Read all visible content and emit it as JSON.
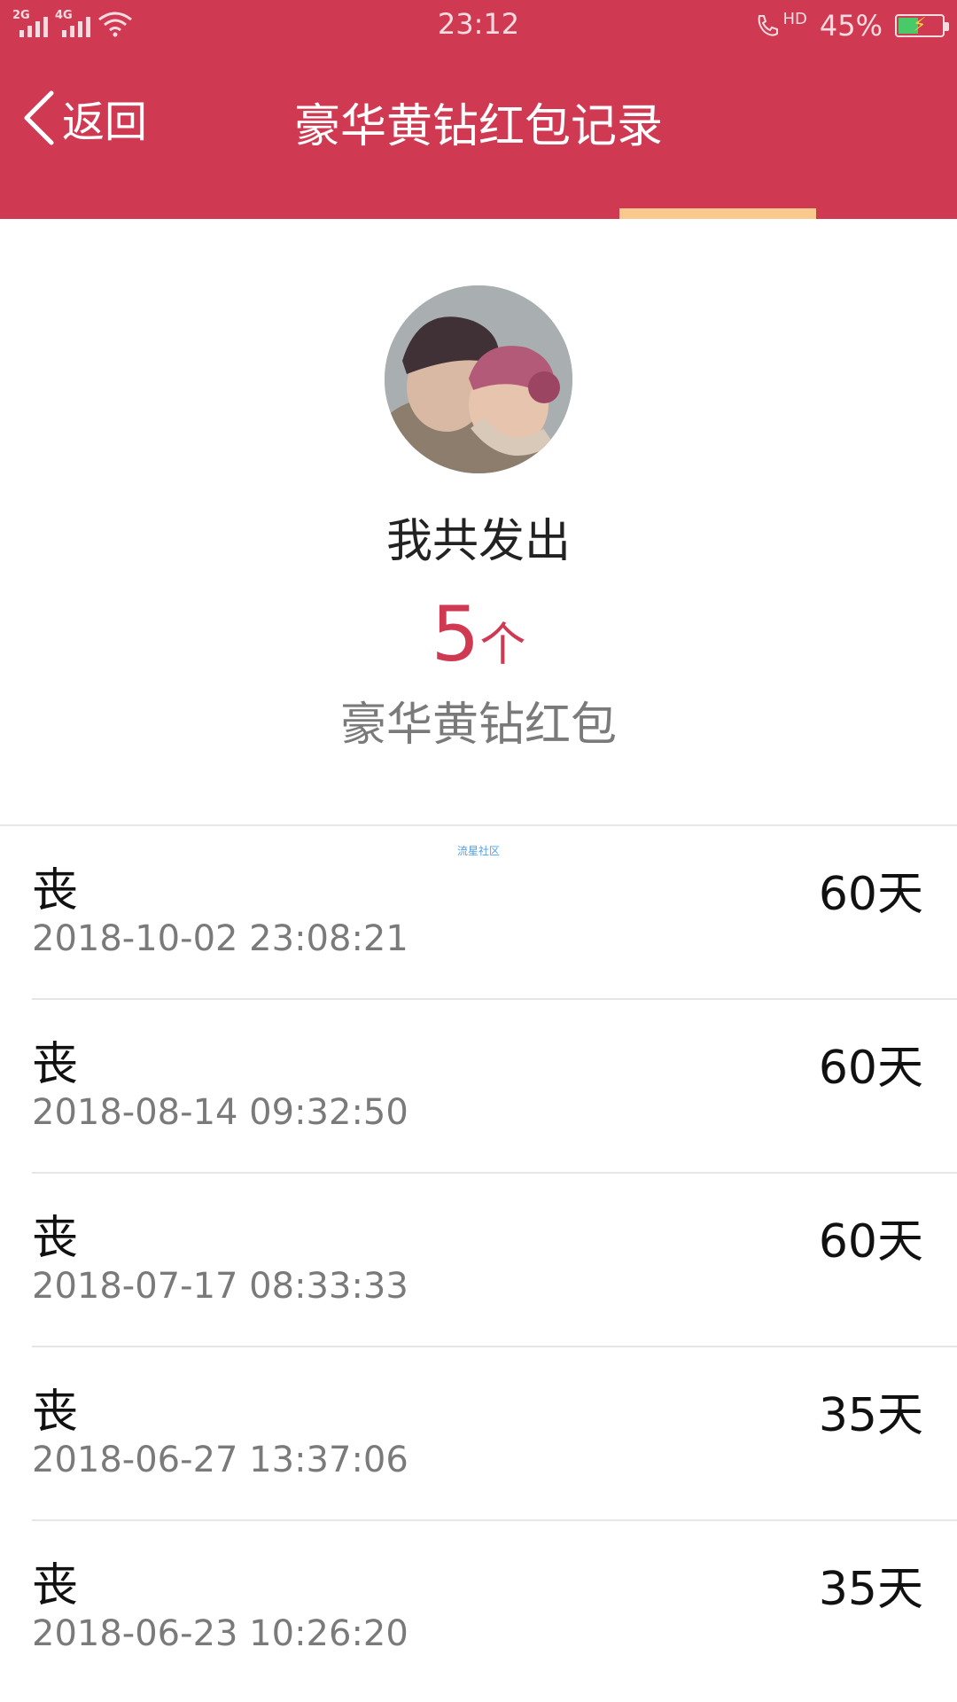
{
  "status_bar": {
    "signal1_label": "2G",
    "signal2_label": "4G",
    "time": "23:12",
    "hd_label": "HD",
    "battery_percent": "45%",
    "battery_level": 0.45,
    "icons": [
      "signal-icon",
      "wifi-icon",
      "call-icon",
      "battery-icon"
    ]
  },
  "nav": {
    "back_label": "返回",
    "title": "豪华黄钻红包记录"
  },
  "summary": {
    "label": "我共发出",
    "count": "5",
    "unit": "个",
    "item": "豪华黄钻红包"
  },
  "watermark": "流星社区",
  "records": [
    {
      "name": "丧",
      "time": "2018-10-02 23:08:21",
      "duration": "60天"
    },
    {
      "name": "丧",
      "time": "2018-08-14 09:32:50",
      "duration": "60天"
    },
    {
      "name": "丧",
      "time": "2018-07-17 08:33:33",
      "duration": "60天"
    },
    {
      "name": "丧",
      "time": "2018-06-27 13:37:06",
      "duration": "35天"
    },
    {
      "name": "丧",
      "time": "2018-06-23 10:26:20",
      "duration": "35天"
    }
  ],
  "colors": {
    "brand": "#cf3a52",
    "tab_indicator": "#f9c98d",
    "secondary_text": "#7a7a7a"
  }
}
